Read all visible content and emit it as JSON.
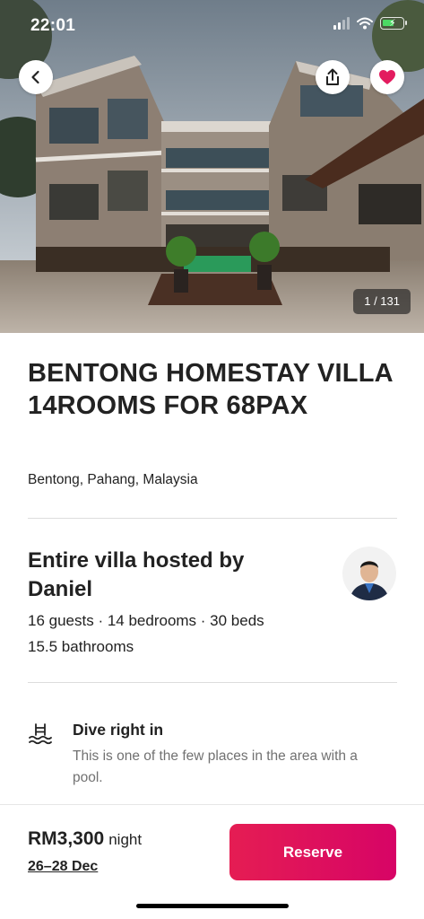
{
  "status_bar": {
    "time": "22:01"
  },
  "hero": {
    "photo_counter": "1 / 131",
    "back_icon": "chevron-left-icon",
    "share_icon": "share-icon",
    "save_icon": "heart-icon",
    "save_color": "#e31c5f"
  },
  "listing": {
    "title": "BENTONG HOMESTAY VILLA 14ROOMS FOR 68PAX",
    "location": "Bentong, Pahang, Malaysia"
  },
  "host": {
    "title": "Entire villa hosted by Daniel",
    "stats_line1": "16 guests · 14 bedrooms · 30 beds",
    "stats_line2": "15.5 bathrooms"
  },
  "highlight": {
    "icon": "pool-icon",
    "title": "Dive right in",
    "description": "This is one of the few places in the area with a pool."
  },
  "footer": {
    "price": "RM3,300",
    "price_unit": "night",
    "dates": "26–28 Dec",
    "reserve_label": "Reserve",
    "reserve_color": "#e51d53"
  }
}
